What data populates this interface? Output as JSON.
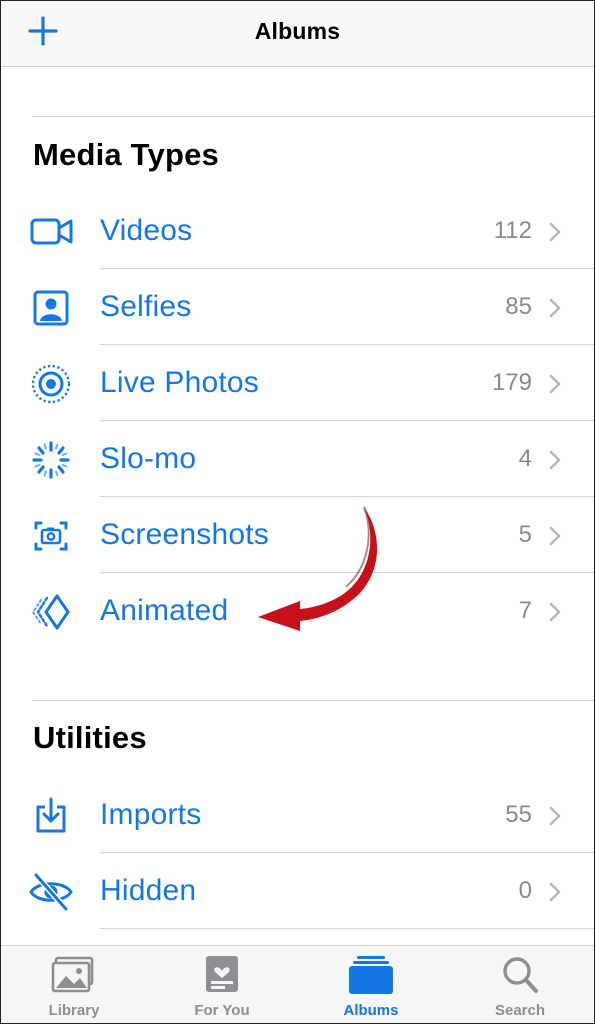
{
  "nav": {
    "title": "Albums",
    "add_icon": "plus-icon"
  },
  "accent_color": "#1577e6",
  "sections": {
    "media_types": {
      "title": "Media Types",
      "items": [
        {
          "label": "Videos",
          "count": "112",
          "icon": "video-camera-icon"
        },
        {
          "label": "Selfies",
          "count": "85",
          "icon": "selfie-portrait-icon"
        },
        {
          "label": "Live Photos",
          "count": "179",
          "icon": "live-photo-icon"
        },
        {
          "label": "Slo-mo",
          "count": "4",
          "icon": "slo-mo-icon"
        },
        {
          "label": "Screenshots",
          "count": "5",
          "icon": "screenshot-icon"
        },
        {
          "label": "Animated",
          "count": "7",
          "icon": "animated-icon"
        }
      ]
    },
    "utilities": {
      "title": "Utilities",
      "items": [
        {
          "label": "Imports",
          "count": "55",
          "icon": "import-tray-icon"
        },
        {
          "label": "Hidden",
          "count": "0",
          "icon": "eye-slash-icon"
        }
      ]
    }
  },
  "annotation": {
    "icon": "red-curved-arrow-icon",
    "color": "#d0101b"
  },
  "tabbar": {
    "tabs": [
      {
        "label": "Library",
        "icon": "photo-library-icon",
        "active": false
      },
      {
        "label": "For You",
        "icon": "for-you-heart-icon",
        "active": false
      },
      {
        "label": "Albums",
        "icon": "albums-stack-icon",
        "active": true
      },
      {
        "label": "Search",
        "icon": "magnifier-icon",
        "active": false
      }
    ]
  }
}
